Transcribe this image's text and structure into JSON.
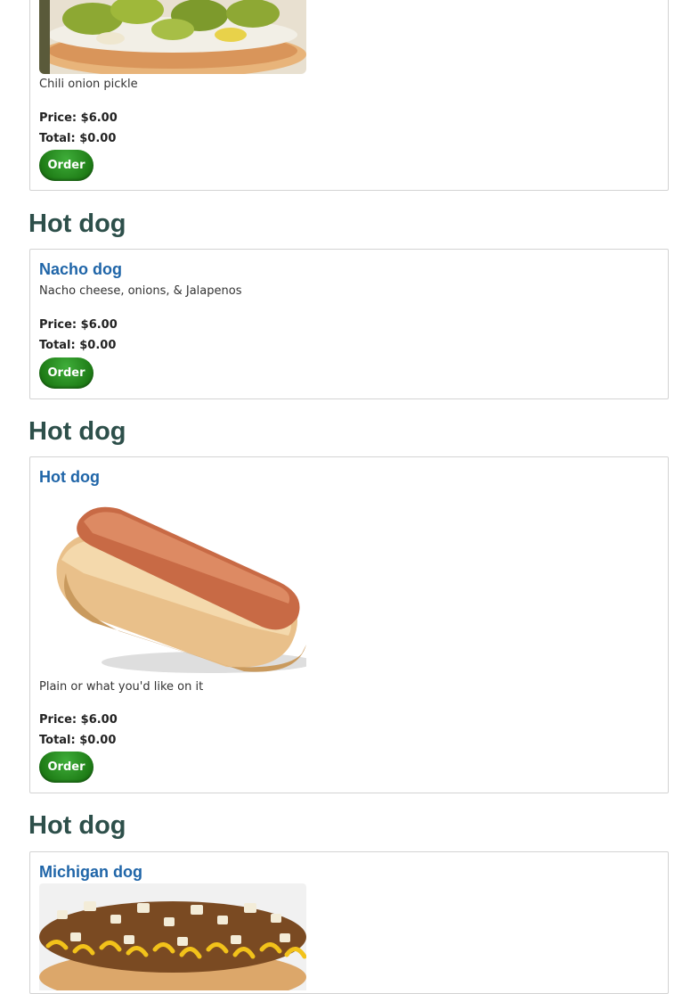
{
  "cards": [
    {
      "description": "Chili onion pickle",
      "price": "Price: $6.00",
      "total": "Total: $0.00",
      "order_label": "Order",
      "image_icon": "hot-dog-pickles-image"
    },
    {
      "heading": "Hot dog",
      "title": "Nacho dog",
      "description": "Nacho cheese, onions, & Jalapenos",
      "price": "Price: $6.00",
      "total": "Total: $0.00",
      "order_label": "Order"
    },
    {
      "heading": "Hot dog",
      "title": "Hot dog",
      "description": "Plain or what you'd like on it",
      "price": "Price: $6.00",
      "total": "Total: $0.00",
      "order_label": "Order",
      "image_icon": "plain-hot-dog-image"
    },
    {
      "heading": "Hot dog",
      "title": "Michigan dog",
      "image_icon": "michigan-dog-image"
    }
  ],
  "colors": {
    "heading": "#2d4f4a",
    "item_title": "#1f65a8",
    "order_button": "#1f7d17",
    "card_border": "#d3d3d3"
  }
}
